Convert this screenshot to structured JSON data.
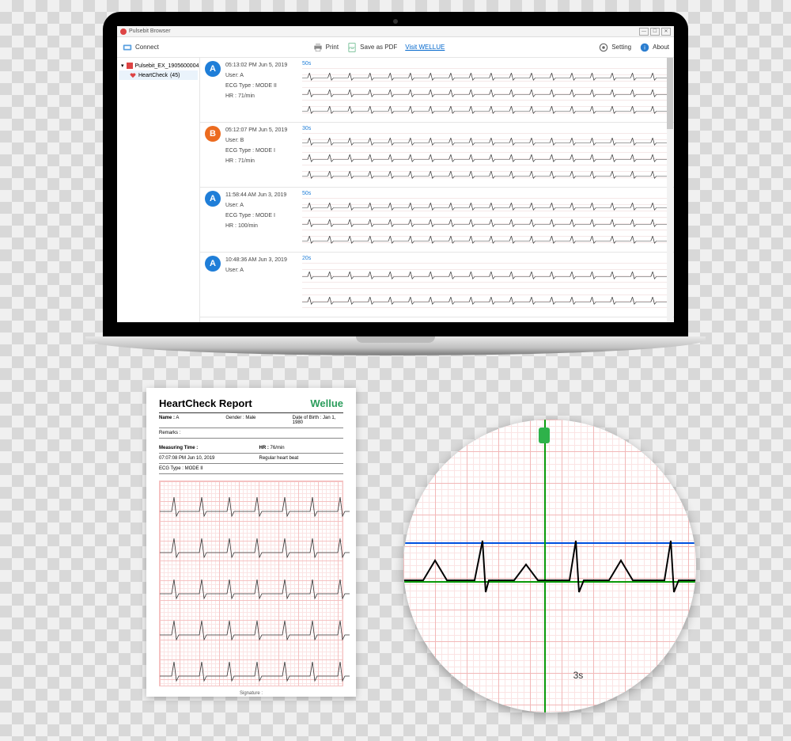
{
  "app": {
    "title": "Pulsebit Browser"
  },
  "toolbar": {
    "connect": "Connect",
    "print": "Print",
    "save_pdf": "Save as PDF",
    "link": "Visit WELLUE",
    "setting": "Setting",
    "about": "About"
  },
  "sidebar": {
    "device": "Pulsebit_EX_1905600004",
    "child_prefix": "HeartCheck",
    "child_count": "(45)"
  },
  "records": [
    {
      "badge": "A",
      "badge_class": "badge-a",
      "timestamp": "05:13:02 PM Jun 5, 2019",
      "user": "User: A",
      "ecg_type": "ECG Type : MODE II",
      "hr": "HR : 71/min",
      "duration": "50s",
      "tracks": 3
    },
    {
      "badge": "B",
      "badge_class": "badge-b",
      "timestamp": "05:12:07 PM Jun 5, 2019",
      "user": "User: B",
      "ecg_type": "ECG Type : MODE I",
      "hr": "HR : 71/min",
      "duration": "30s",
      "tracks": 3
    },
    {
      "badge": "A",
      "badge_class": "badge-a",
      "timestamp": "11:58:44 AM Jun 3, 2019",
      "user": "User: A",
      "ecg_type": "ECG Type : MODE I",
      "hr": "HR : 100/min",
      "duration": "50s",
      "tracks": 3
    },
    {
      "badge": "A",
      "badge_class": "badge-a",
      "timestamp": "10:48:36 AM Jun 3, 2019",
      "user": "User: A",
      "ecg_type": "",
      "hr": "",
      "duration": "20s",
      "tracks": 2
    }
  ],
  "report": {
    "title": "HeartCheck Report",
    "brand": "Wellue",
    "name_label": "Name :",
    "name_value": "A",
    "gender_label": "Gender : Male",
    "dob_label": "Date of Birth : Jan 1, 1980",
    "remarks_label": "Remarks :",
    "measuring_time_label": "Measuring Time :",
    "measuring_time_value": "07:07:08 PM Jun 10, 2019",
    "hr_label": "HR :",
    "hr_value": "76/min",
    "ecg_type_label": "ECG Type : MODE II",
    "result": "Regular heart beat",
    "signature": "Signature :"
  },
  "magnifier": {
    "time_label": "3s"
  }
}
